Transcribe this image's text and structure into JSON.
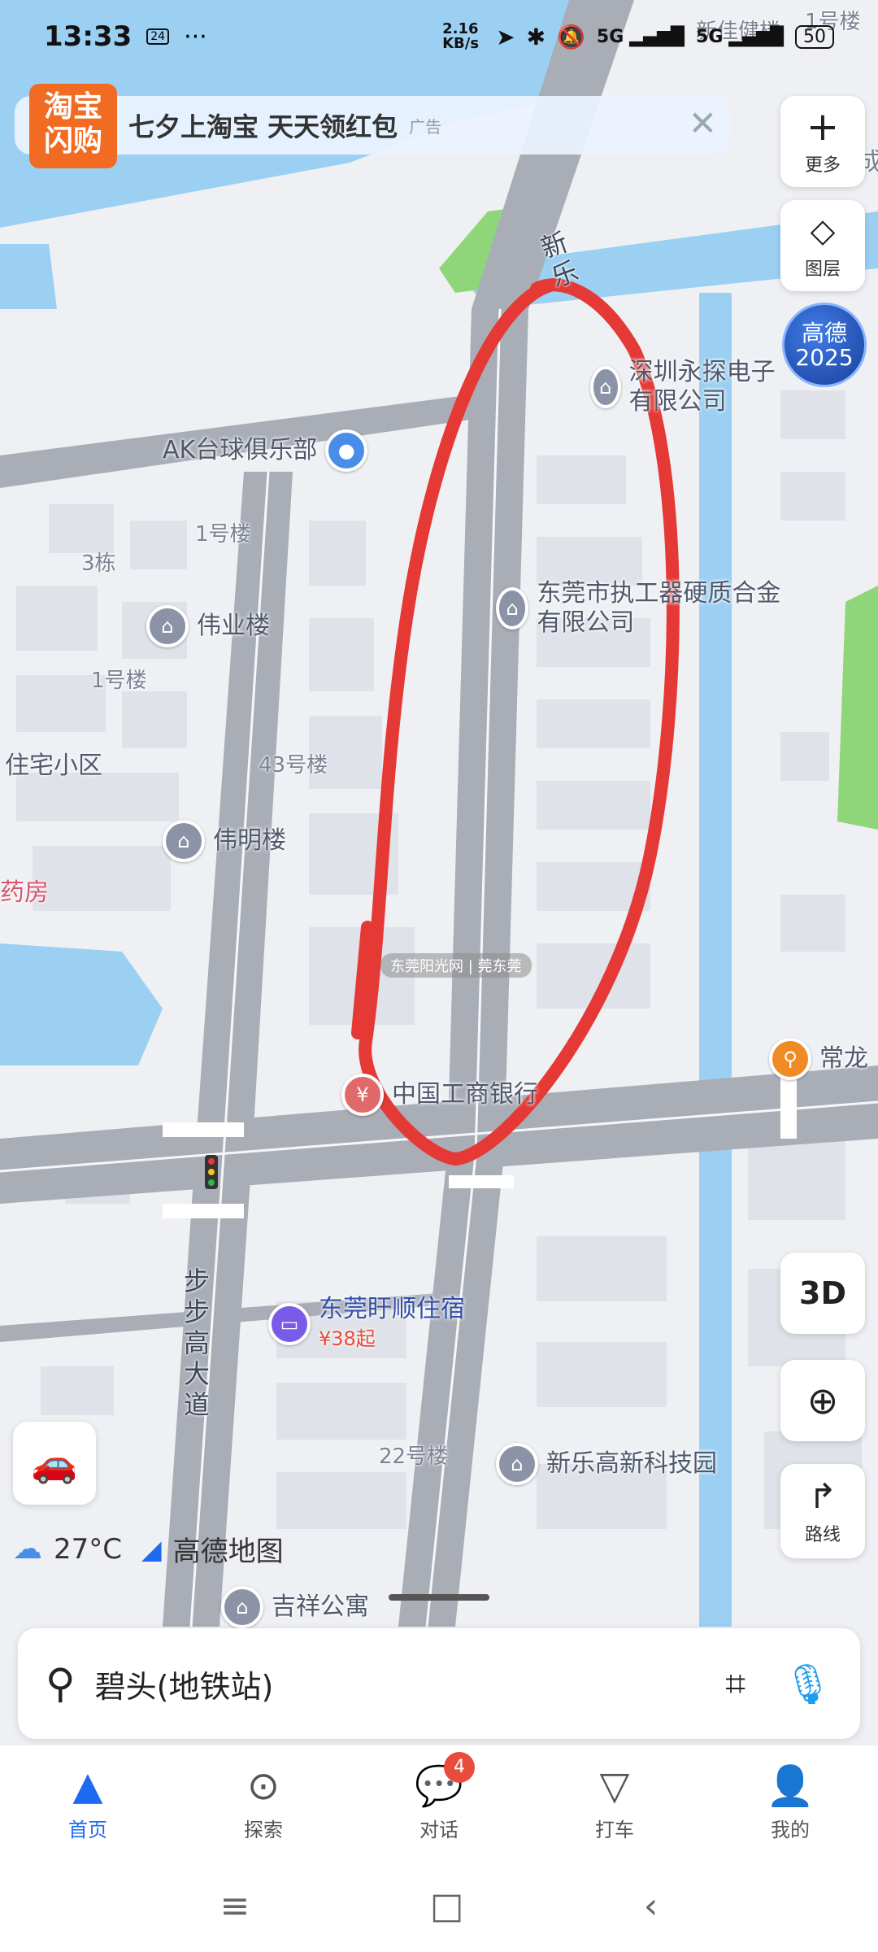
{
  "status_bar": {
    "time": "13:33",
    "date_icon": "24",
    "dots": "···",
    "speed": "2.16 KB/s",
    "net1": "5G",
    "net2": "5G",
    "battery": "50"
  },
  "ad": {
    "logo": "淘宝闪购",
    "text": "七夕上淘宝 天天领红包",
    "tag": "广告",
    "close": "✕"
  },
  "right_buttons": {
    "more_label": "更多",
    "layers_label": "图层",
    "badge_line1": "高德",
    "badge_line2": "2025",
    "btn_3d": "3D",
    "route_label": "路线"
  },
  "map_pois": {
    "p1": "深圳永探电子有限公司",
    "p2": "AK台球俱乐部",
    "p3": "伟业楼",
    "p4": "东莞市执工器硬质合金有限公司",
    "p5": "伟明楼",
    "p6": "中国工商银行",
    "p7": "常龙",
    "p8": "东莞盱顺住宿",
    "p8_price": "¥38起",
    "p9": "新乐高新科技园",
    "p10": "吉祥公寓"
  },
  "map_labels": {
    "l1": "1号楼",
    "l2": "3栋",
    "l3": "1号楼",
    "l4": "住宅小区",
    "l5": "43号楼",
    "l6": "药房",
    "l7": "22号楼",
    "l8": "1号楼",
    "l9": "新佳健楼",
    "l10": "成",
    "road1": "步步高大道",
    "road2": "新乐"
  },
  "weather": {
    "temp": "27°C",
    "app": "高德地图"
  },
  "watermark": "东莞阳光网 | 莞东莞",
  "search": {
    "text": "碧头(地铁站)"
  },
  "nav": {
    "home": "首页",
    "explore": "探索",
    "chat": "对话",
    "chat_badge": "4",
    "taxi": "打车",
    "mine": "我的"
  },
  "colors": {
    "accent": "#1e6bf0",
    "water": "#9bd0f2",
    "road": "#a9adb6",
    "annotation": "#e53935",
    "green": "#8fd67a"
  }
}
